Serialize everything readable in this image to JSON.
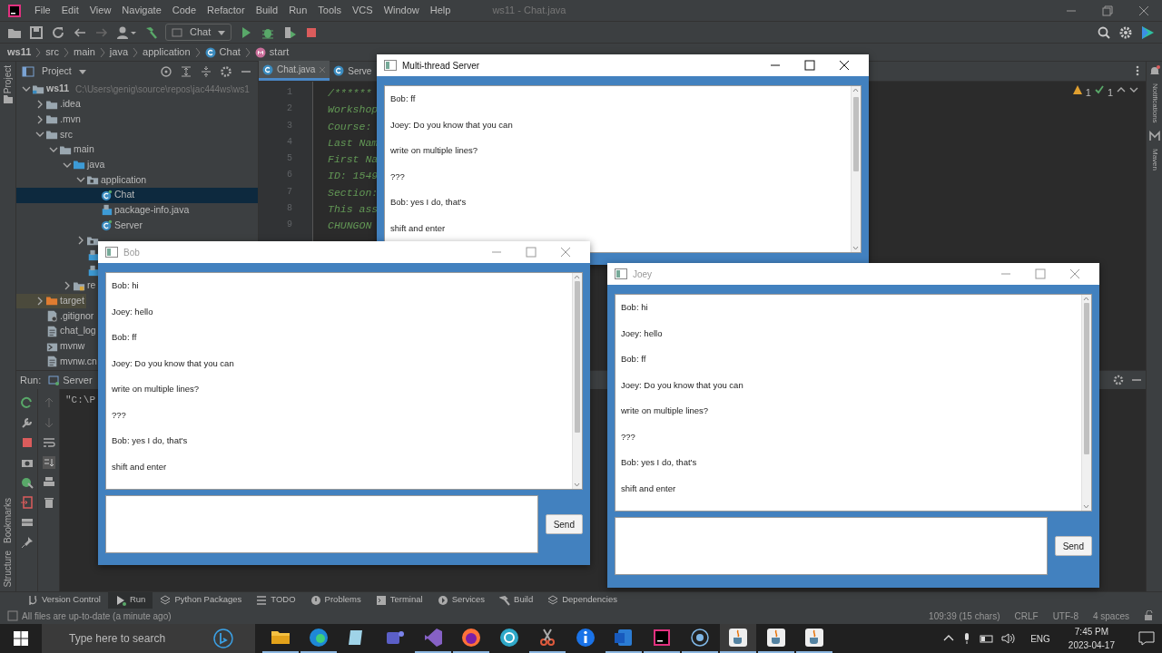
{
  "title_bar": {
    "menu": [
      "File",
      "Edit",
      "View",
      "Navigate",
      "Code",
      "Refactor",
      "Build",
      "Run",
      "Tools",
      "VCS",
      "Window",
      "Help"
    ],
    "title": "ws11 - Chat.java"
  },
  "toolbar": {
    "run_config": "Chat"
  },
  "breadcrumbs": [
    {
      "label": "ws11",
      "kind": "module"
    },
    {
      "label": "src",
      "kind": "folder"
    },
    {
      "label": "main",
      "kind": "folder"
    },
    {
      "label": "java",
      "kind": "folder"
    },
    {
      "label": "application",
      "kind": "folder"
    },
    {
      "label": "Chat",
      "kind": "class"
    },
    {
      "label": "start",
      "kind": "method"
    }
  ],
  "left_stripe": [
    "Project",
    "Bookmarks",
    "Structure"
  ],
  "right_stripe": [
    "Notifications",
    "Maven"
  ],
  "project_panel": {
    "title": "Project",
    "tree": [
      {
        "label": "ws11",
        "path": "C:\\Users\\genig\\source\\repos\\jac444ws\\ws1",
        "kind": "module",
        "expanded": true,
        "selected": false,
        "children": [
          {
            "label": ".idea",
            "kind": "folder",
            "expanded": false,
            "selected": false
          },
          {
            "label": ".mvn",
            "kind": "folder",
            "expanded": false,
            "selected": false
          },
          {
            "label": "src",
            "kind": "folder",
            "expanded": true,
            "selected": false,
            "children": [
              {
                "label": "main",
                "kind": "folder",
                "expanded": true,
                "selected": false,
                "children": [
                  {
                    "label": "java",
                    "kind": "source",
                    "expanded": true,
                    "selected": false,
                    "children": [
                      {
                        "label": "application",
                        "kind": "package",
                        "expanded": true,
                        "selected": false,
                        "children": [
                          {
                            "label": "Chat",
                            "kind": "class",
                            "selected": true
                          },
                          {
                            "label": "package-info.java",
                            "kind": "info",
                            "selected": false
                          },
                          {
                            "label": "Server",
                            "kind": "class",
                            "selected": false
                          }
                        ]
                      },
                      {
                        "kind": "package",
                        "expanded": false,
                        "selected": false
                      },
                      {
                        "kind": "info",
                        "selected": false
                      },
                      {
                        "kind": "info",
                        "selected": false
                      }
                    ]
                  },
                  {
                    "label": "re",
                    "kind": "resources",
                    "expanded": false,
                    "selected": false
                  }
                ]
              }
            ]
          },
          {
            "label": "target",
            "kind": "excluded",
            "expanded": false,
            "selected": false
          },
          {
            "label": ".gitignor",
            "kind": "ignore",
            "selected": false
          },
          {
            "label": "chat_log",
            "kind": "text",
            "selected": false
          },
          {
            "label": "mvnw",
            "kind": "script",
            "selected": false
          },
          {
            "label": "mvnw.cn",
            "kind": "text",
            "selected": false
          }
        ]
      }
    ]
  },
  "editor": {
    "tabs": [
      {
        "label": "Chat.java",
        "selected": true
      },
      {
        "label": "Serve",
        "selected": false
      }
    ],
    "lines": [
      {
        "number": "1",
        "text": "/******"
      },
      {
        "number": "2",
        "text": "Workshop"
      },
      {
        "number": "3",
        "text": "Course:"
      },
      {
        "number": "4",
        "text": "Last Nam"
      },
      {
        "number": "5",
        "text": "First Na"
      },
      {
        "number": "6",
        "text": "ID: 1549"
      },
      {
        "number": "7",
        "text": "Section:"
      },
      {
        "number": "8",
        "text": "This ass"
      },
      {
        "number": "9",
        "text": "CHUNGON"
      }
    ],
    "warnings": "1",
    "checks": "1"
  },
  "run_panel": {
    "label": "Run:",
    "config": "Server",
    "console": "\"C:\\P"
  },
  "tool_tabs": [
    {
      "label": "Version Control",
      "selected": false
    },
    {
      "label": "Run",
      "selected": true
    },
    {
      "label": "Python Packages",
      "selected": false
    },
    {
      "label": "TODO",
      "selected": false
    },
    {
      "label": "Problems",
      "selected": false
    },
    {
      "label": "Terminal",
      "selected": false
    },
    {
      "label": "Services",
      "selected": false
    },
    {
      "label": "Build",
      "selected": false
    },
    {
      "label": "Dependencies",
      "selected": false
    }
  ],
  "status_bar": {
    "message": "All files are up-to-date (a minute ago)",
    "position": "109:39 (15 chars)",
    "line_ending": "CRLF",
    "encoding": "UTF-8",
    "indent": "4 spaces"
  },
  "windows": [
    {
      "title": "Multi-thread Server",
      "active": true,
      "messages": [
        "Bob: ff",
        "Joey: Do you know that you can",
        "write on multiple lines?",
        "???",
        "Bob: yes I do,  that's",
        "shift and enter"
      ]
    },
    {
      "title": "Bob",
      "active": false,
      "messages": [
        "Bob: hi",
        "Joey: hello",
        "Bob: ff",
        "Joey: Do you know that you can",
        "write on multiple lines?",
        "???",
        "Bob: yes I do,  that's",
        "shift and enter"
      ],
      "send": "Send"
    },
    {
      "title": "Joey",
      "active": false,
      "messages": [
        "Bob: hi",
        "Joey: hello",
        "Bob: ff",
        "Joey: Do you know that you can",
        "write on multiple lines?",
        "???",
        "Bob: yes I do,  that's",
        "shift and enter"
      ],
      "send": "Send"
    }
  ],
  "taskbar": {
    "search_placeholder": "Type here to search",
    "language": "ENG",
    "time": "7:45 PM",
    "date": "2023-04-17"
  }
}
